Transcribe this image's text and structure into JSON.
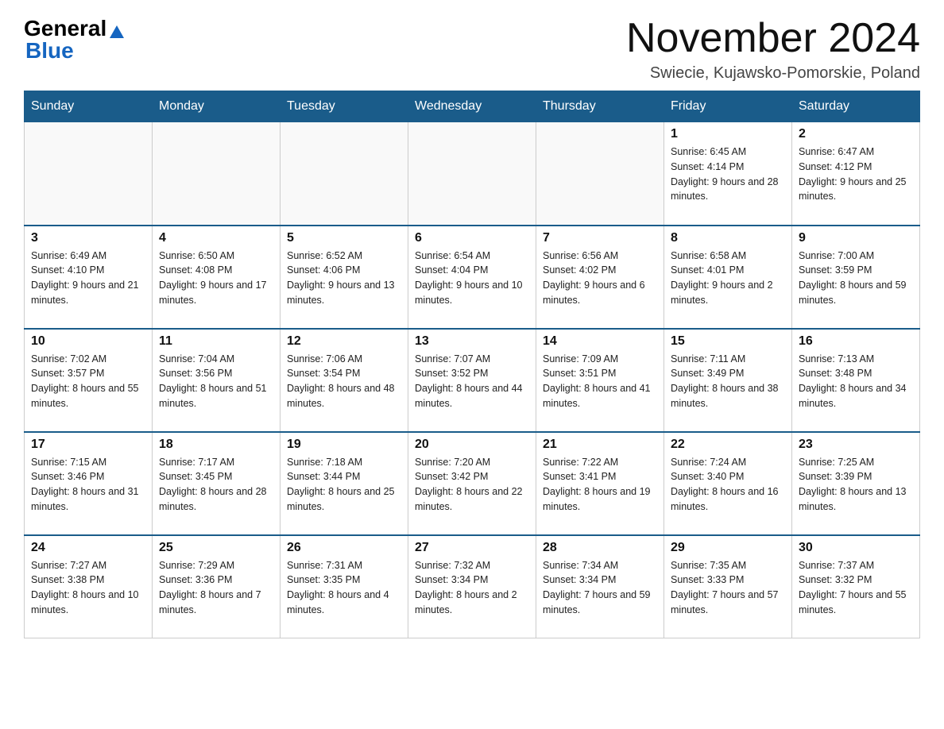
{
  "header": {
    "logo_general": "General",
    "logo_blue": "Blue",
    "month_title": "November 2024",
    "location": "Swiecie, Kujawsko-Pomorskie, Poland"
  },
  "days_of_week": [
    "Sunday",
    "Monday",
    "Tuesday",
    "Wednesday",
    "Thursday",
    "Friday",
    "Saturday"
  ],
  "weeks": [
    [
      {
        "day": "",
        "info": ""
      },
      {
        "day": "",
        "info": ""
      },
      {
        "day": "",
        "info": ""
      },
      {
        "day": "",
        "info": ""
      },
      {
        "day": "",
        "info": ""
      },
      {
        "day": "1",
        "info": "Sunrise: 6:45 AM\nSunset: 4:14 PM\nDaylight: 9 hours and 28 minutes."
      },
      {
        "day": "2",
        "info": "Sunrise: 6:47 AM\nSunset: 4:12 PM\nDaylight: 9 hours and 25 minutes."
      }
    ],
    [
      {
        "day": "3",
        "info": "Sunrise: 6:49 AM\nSunset: 4:10 PM\nDaylight: 9 hours and 21 minutes."
      },
      {
        "day": "4",
        "info": "Sunrise: 6:50 AM\nSunset: 4:08 PM\nDaylight: 9 hours and 17 minutes."
      },
      {
        "day": "5",
        "info": "Sunrise: 6:52 AM\nSunset: 4:06 PM\nDaylight: 9 hours and 13 minutes."
      },
      {
        "day": "6",
        "info": "Sunrise: 6:54 AM\nSunset: 4:04 PM\nDaylight: 9 hours and 10 minutes."
      },
      {
        "day": "7",
        "info": "Sunrise: 6:56 AM\nSunset: 4:02 PM\nDaylight: 9 hours and 6 minutes."
      },
      {
        "day": "8",
        "info": "Sunrise: 6:58 AM\nSunset: 4:01 PM\nDaylight: 9 hours and 2 minutes."
      },
      {
        "day": "9",
        "info": "Sunrise: 7:00 AM\nSunset: 3:59 PM\nDaylight: 8 hours and 59 minutes."
      }
    ],
    [
      {
        "day": "10",
        "info": "Sunrise: 7:02 AM\nSunset: 3:57 PM\nDaylight: 8 hours and 55 minutes."
      },
      {
        "day": "11",
        "info": "Sunrise: 7:04 AM\nSunset: 3:56 PM\nDaylight: 8 hours and 51 minutes."
      },
      {
        "day": "12",
        "info": "Sunrise: 7:06 AM\nSunset: 3:54 PM\nDaylight: 8 hours and 48 minutes."
      },
      {
        "day": "13",
        "info": "Sunrise: 7:07 AM\nSunset: 3:52 PM\nDaylight: 8 hours and 44 minutes."
      },
      {
        "day": "14",
        "info": "Sunrise: 7:09 AM\nSunset: 3:51 PM\nDaylight: 8 hours and 41 minutes."
      },
      {
        "day": "15",
        "info": "Sunrise: 7:11 AM\nSunset: 3:49 PM\nDaylight: 8 hours and 38 minutes."
      },
      {
        "day": "16",
        "info": "Sunrise: 7:13 AM\nSunset: 3:48 PM\nDaylight: 8 hours and 34 minutes."
      }
    ],
    [
      {
        "day": "17",
        "info": "Sunrise: 7:15 AM\nSunset: 3:46 PM\nDaylight: 8 hours and 31 minutes."
      },
      {
        "day": "18",
        "info": "Sunrise: 7:17 AM\nSunset: 3:45 PM\nDaylight: 8 hours and 28 minutes."
      },
      {
        "day": "19",
        "info": "Sunrise: 7:18 AM\nSunset: 3:44 PM\nDaylight: 8 hours and 25 minutes."
      },
      {
        "day": "20",
        "info": "Sunrise: 7:20 AM\nSunset: 3:42 PM\nDaylight: 8 hours and 22 minutes."
      },
      {
        "day": "21",
        "info": "Sunrise: 7:22 AM\nSunset: 3:41 PM\nDaylight: 8 hours and 19 minutes."
      },
      {
        "day": "22",
        "info": "Sunrise: 7:24 AM\nSunset: 3:40 PM\nDaylight: 8 hours and 16 minutes."
      },
      {
        "day": "23",
        "info": "Sunrise: 7:25 AM\nSunset: 3:39 PM\nDaylight: 8 hours and 13 minutes."
      }
    ],
    [
      {
        "day": "24",
        "info": "Sunrise: 7:27 AM\nSunset: 3:38 PM\nDaylight: 8 hours and 10 minutes."
      },
      {
        "day": "25",
        "info": "Sunrise: 7:29 AM\nSunset: 3:36 PM\nDaylight: 8 hours and 7 minutes."
      },
      {
        "day": "26",
        "info": "Sunrise: 7:31 AM\nSunset: 3:35 PM\nDaylight: 8 hours and 4 minutes."
      },
      {
        "day": "27",
        "info": "Sunrise: 7:32 AM\nSunset: 3:34 PM\nDaylight: 8 hours and 2 minutes."
      },
      {
        "day": "28",
        "info": "Sunrise: 7:34 AM\nSunset: 3:34 PM\nDaylight: 7 hours and 59 minutes."
      },
      {
        "day": "29",
        "info": "Sunrise: 7:35 AM\nSunset: 3:33 PM\nDaylight: 7 hours and 57 minutes."
      },
      {
        "day": "30",
        "info": "Sunrise: 7:37 AM\nSunset: 3:32 PM\nDaylight: 7 hours and 55 minutes."
      }
    ]
  ]
}
